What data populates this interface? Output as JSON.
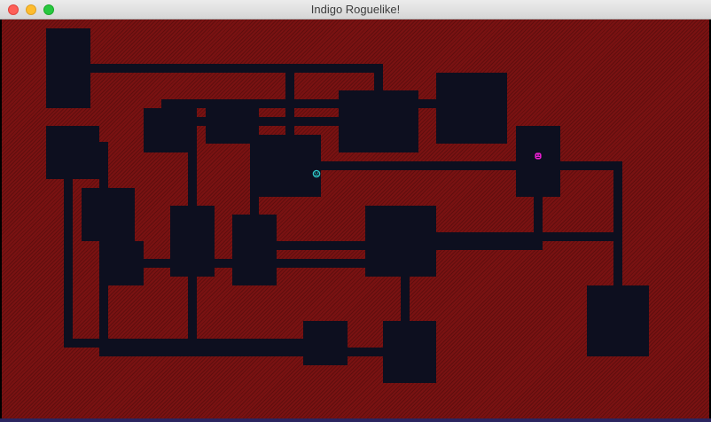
{
  "window": {
    "title": "Indigo Roguelike!"
  },
  "colors": {
    "wall": "#7a1212",
    "floor": "#0d0f1f",
    "player": "#2ec7c7",
    "monster": "#e81ed0"
  },
  "icons": {
    "player": "player-face-icon",
    "monster": "monster-face-icon"
  }
}
